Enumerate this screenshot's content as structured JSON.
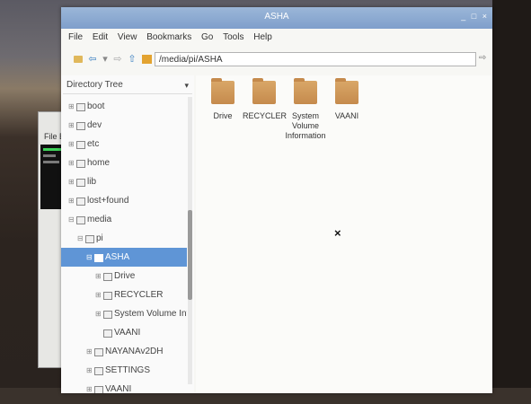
{
  "bg_window": {
    "menu_text": "File E"
  },
  "window": {
    "title": "ASHA",
    "controls": [
      "_",
      "□",
      "×"
    ]
  },
  "menubar": [
    "File",
    "Edit",
    "View",
    "Bookmarks",
    "Go",
    "Tools",
    "Help"
  ],
  "toolbar": {
    "address": "/media/pi/ASHA"
  },
  "sidebar": {
    "header": "Directory Tree",
    "items": [
      {
        "label": "boot",
        "expander": "⊞",
        "depth": 0,
        "selected": false
      },
      {
        "label": "dev",
        "expander": "⊞",
        "depth": 0,
        "selected": false
      },
      {
        "label": "etc",
        "expander": "⊞",
        "depth": 0,
        "selected": false
      },
      {
        "label": "home",
        "expander": "⊞",
        "depth": 0,
        "selected": false
      },
      {
        "label": "lib",
        "expander": "⊞",
        "depth": 0,
        "selected": false
      },
      {
        "label": "lost+found",
        "expander": "⊞",
        "depth": 0,
        "selected": false
      },
      {
        "label": "media",
        "expander": "⊟",
        "depth": 0,
        "selected": false
      },
      {
        "label": "pi",
        "expander": "⊟",
        "depth": 1,
        "selected": false
      },
      {
        "label": "ASHA",
        "expander": "⊟",
        "depth": 2,
        "selected": true
      },
      {
        "label": "Drive",
        "expander": "⊞",
        "depth": 3,
        "selected": false
      },
      {
        "label": "RECYCLER",
        "expander": "⊞",
        "depth": 3,
        "selected": false
      },
      {
        "label": "System Volume Informat",
        "expander": "⊞",
        "depth": 3,
        "selected": false
      },
      {
        "label": "VAANI",
        "expander": "",
        "depth": 3,
        "selected": false
      },
      {
        "label": "NAYANAv2DH",
        "expander": "⊞",
        "depth": 2,
        "selected": false
      },
      {
        "label": "SETTINGS",
        "expander": "⊞",
        "depth": 2,
        "selected": false
      },
      {
        "label": "VAANI",
        "expander": "⊞",
        "depth": 2,
        "selected": false
      }
    ]
  },
  "content": {
    "files": [
      {
        "name": "Drive"
      },
      {
        "name": "RECYCLER"
      },
      {
        "name": "System Volume Information"
      },
      {
        "name": "VAANI"
      }
    ],
    "cursor_mark": "×"
  }
}
